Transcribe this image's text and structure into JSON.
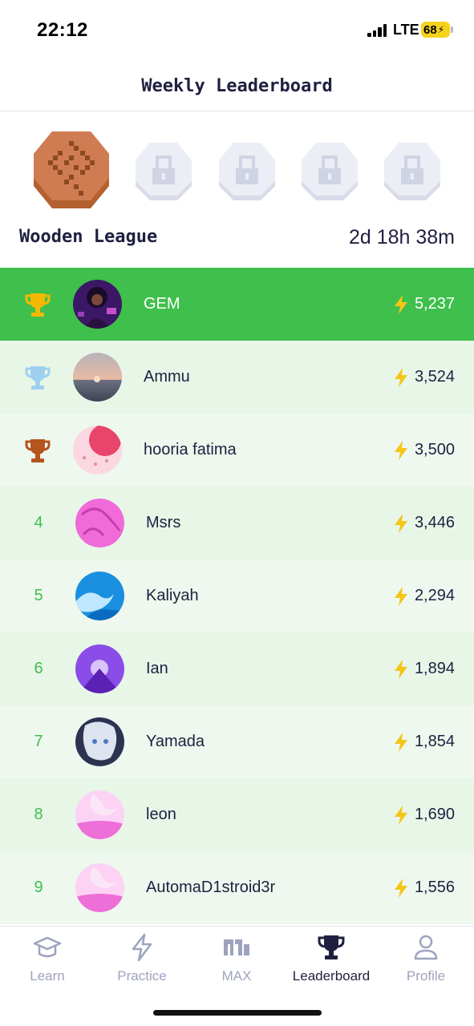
{
  "status_bar": {
    "time": "22:12",
    "network": "LTE",
    "battery": "68"
  },
  "header": {
    "title": "Weekly Leaderboard"
  },
  "league": {
    "name": "Wooden League",
    "time_remaining": "2d 18h 38m"
  },
  "colors": {
    "accent": "#3fbf4b",
    "gold": "#f5b800",
    "silver": "#9fd0f0",
    "bronze": "#b5541c",
    "bolt": "#f5c518"
  },
  "leaderboard": [
    {
      "rank": "1",
      "trophy": "gold-trophy-icon",
      "name": "GEM",
      "score": "5,237",
      "me": true
    },
    {
      "rank": "2",
      "trophy": "silver-trophy-icon",
      "name": "Ammu",
      "score": "3,524"
    },
    {
      "rank": "3",
      "trophy": "bronze-trophy-icon",
      "name": "hooria fatima",
      "score": "3,500"
    },
    {
      "rank": "4",
      "name": "Msrs",
      "score": "3,446"
    },
    {
      "rank": "5",
      "name": "Kaliyah",
      "score": "2,294"
    },
    {
      "rank": "6",
      "name": "Ian",
      "score": "1,894"
    },
    {
      "rank": "7",
      "name": "Yamada",
      "score": "1,854"
    },
    {
      "rank": "8",
      "name": "leon",
      "score": "1,690"
    },
    {
      "rank": "9",
      "name": "AutomaD1stroid3r",
      "score": "1,556"
    }
  ],
  "tabs": [
    {
      "label": "Learn",
      "icon": "graduation-cap-icon"
    },
    {
      "label": "Practice",
      "icon": "lightning-icon"
    },
    {
      "label": "MAX",
      "icon": "max-logo-icon"
    },
    {
      "label": "Leaderboard",
      "icon": "trophy-icon",
      "active": true
    },
    {
      "label": "Profile",
      "icon": "person-icon"
    }
  ]
}
